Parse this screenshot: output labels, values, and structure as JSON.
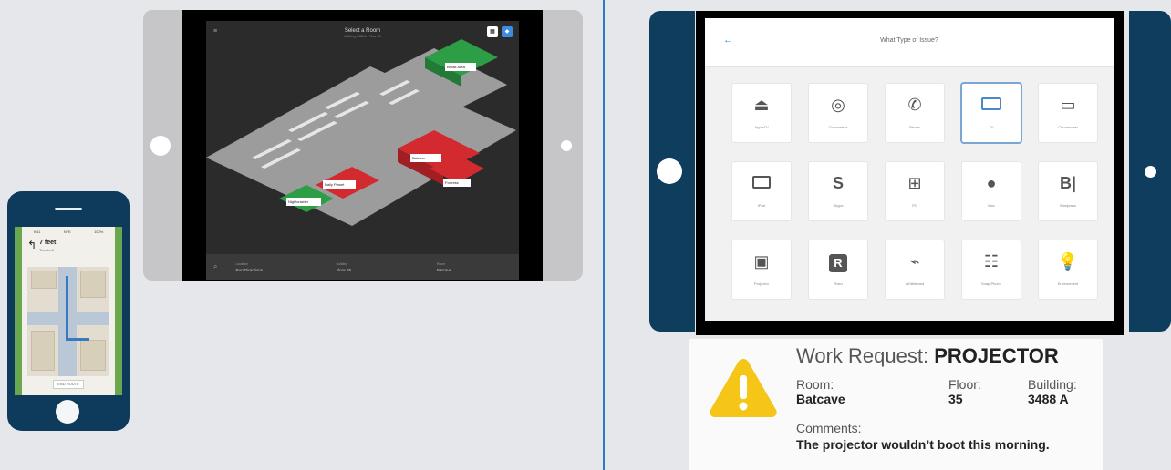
{
  "phone": {
    "status_left": "9:41",
    "status_mid": "NFE",
    "status_right": "100%",
    "direction": "7 feet",
    "direction_sub": "Turn Left",
    "footer": "END ROUTE"
  },
  "tablet1": {
    "title": "Select a Room",
    "subtitle": "Building 3488 A · Floor 35",
    "rooms": [
      {
        "label": "Break Area",
        "sub": "Available"
      },
      {
        "label": "Nightcrawler",
        "sub": "Available"
      },
      {
        "label": "Batcave",
        "sub": "Occupied"
      },
      {
        "label": "Fortress",
        "sub": "Occupied"
      },
      {
        "label": "Daily Planet",
        "sub": "Occupied"
      }
    ],
    "bottombar": [
      {
        "caption": "Location",
        "value": "Run Directions"
      },
      {
        "caption": "Building",
        "value": "Floor 35"
      },
      {
        "caption": "Room",
        "value": "Batcave"
      }
    ]
  },
  "tablet2": {
    "title": "What Type of Issue?",
    "issues": [
      {
        "label": "AppleTV",
        "icon": "airplay-icon"
      },
      {
        "label": "Chromebox",
        "icon": "chrome-icon"
      },
      {
        "label": "Phone",
        "icon": "phone-icon"
      },
      {
        "label": "TV",
        "icon": "tv-icon"
      },
      {
        "label": "Chromecast",
        "icon": "cast-icon"
      },
      {
        "label": "iPad",
        "icon": "tablet-icon"
      },
      {
        "label": "Skype",
        "icon": "skype-icon"
      },
      {
        "label": "PC",
        "icon": "windows-icon"
      },
      {
        "label": "Mac",
        "icon": "apple-icon"
      },
      {
        "label": "Bluejeans",
        "icon": "bluejeans-icon"
      },
      {
        "label": "Projector",
        "icon": "projector-icon"
      },
      {
        "label": "Roku",
        "icon": "roku-icon"
      },
      {
        "label": "Whiteboard",
        "icon": "whiteboard-icon"
      },
      {
        "label": "Snap Phone",
        "icon": "deskphone-icon"
      },
      {
        "label": "Environment",
        "icon": "bulb-icon"
      }
    ],
    "selected": "TV"
  },
  "work_request": {
    "title_prefix": "Work Request: ",
    "title_item": "PROJECTOR",
    "room_label": "Room:",
    "room_value": "Batcave",
    "floor_label": "Floor:",
    "floor_value": "35",
    "building_label": "Building:",
    "building_value": "3488 A",
    "comments_label": "Comments:",
    "comments_value": "The projector wouldn’t boot this morning."
  },
  "colors": {
    "navy": "#0f3d5e",
    "accent": "#3d8ce0",
    "available": "#2e9e46",
    "occupied": "#d22a2f",
    "warning": "#f5c518"
  }
}
